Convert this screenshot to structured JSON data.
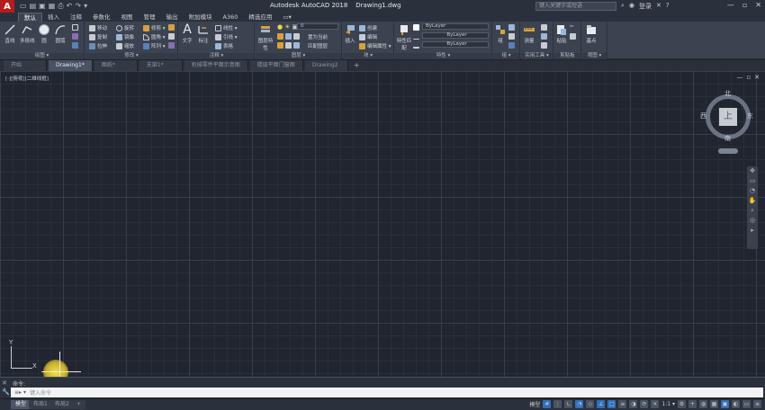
{
  "app": {
    "logo": "A",
    "title": "Autodesk AutoCAD 2018",
    "filename": "Drawing1.dwg",
    "search_placeholder": "键入关键字或短语",
    "login": "登录",
    "window_controls": [
      "—",
      "▫",
      "✕"
    ]
  },
  "menu": {
    "tabs": [
      "默认",
      "插入",
      "注释",
      "参数化",
      "视图",
      "管理",
      "输出",
      "附加模块",
      "A360",
      "精选应用",
      "▭▾"
    ]
  },
  "ribbon": {
    "draw": {
      "title": "绘图 ▾",
      "line": "直线",
      "polyline": "多段线",
      "circle": "圆",
      "arc": "圆弧"
    },
    "modify": {
      "title": "修改 ▾",
      "move": "移动",
      "rotate": "旋转",
      "trim": "修剪 ▾",
      "copy": "复制",
      "mirror": "镜像",
      "fillet": "圆角 ▾",
      "stretch": "拉伸",
      "scale": "缩放",
      "array": "阵列 ▾"
    },
    "annotation": {
      "title": "注释 ▾",
      "text": "文字",
      "dimension": "标注",
      "linear": "线性 ▾",
      "leader": "引线 ▾",
      "table": "表格"
    },
    "layers": {
      "title": "图层 ▾",
      "layer_props": "图层特性",
      "layer_combo": "0",
      "make_current": "置为当前",
      "match_layer": "匹配图层"
    },
    "block": {
      "title": "块 ▾",
      "insert": "插入",
      "create": "创建",
      "edit": "编辑",
      "edit_attr": "编辑属性 ▾"
    },
    "properties": {
      "title": "特性 ▾",
      "match": "特性匹配",
      "color": "ByLayer",
      "linetype": "ByLayer",
      "lineweight": "ByLayer"
    },
    "groups": {
      "title": "组 ▾",
      "group": "组"
    },
    "utilities": {
      "title": "实用工具 ▾",
      "measure": "测量"
    },
    "clipboard": {
      "title": "剪贴板",
      "paste": "粘贴"
    },
    "view": {
      "title": "视图 ▾",
      "base": "基点"
    }
  },
  "doctabs": {
    "items": [
      "开始",
      "Drawing1*",
      "图纸*",
      "支架1*",
      "机械零件平面示意图",
      "楼层平面门窗图",
      "Drawing2"
    ],
    "add": "+"
  },
  "viewport": {
    "label": "[-][俯视][二维线框]",
    "controls": [
      "—",
      "▫",
      "✕"
    ],
    "viewcube": {
      "face": "上",
      "north": "北",
      "south": "南",
      "east": "东",
      "west": "西"
    },
    "ucs": {
      "x": "X",
      "y": "Y"
    },
    "nav_buttons": [
      "✥",
      "▭",
      "◔",
      "✋",
      "⌕",
      "◎",
      "▸"
    ]
  },
  "command": {
    "history": "命令:",
    "prompt": "≡▸ ▾",
    "placeholder": "键入命令",
    "side_buttons": [
      "✕",
      "🔧"
    ]
  },
  "status": {
    "layout_tabs": [
      "模型",
      "布局1",
      "布局2"
    ],
    "add": "+",
    "model_label": "模型",
    "scale": "1:1 ▾"
  },
  "colors": {
    "accent": "#2f6fbf",
    "logo": "#b51c1c",
    "canvas": "#21252f",
    "ribbon": "#3b4351",
    "cursor_highlight": "#ffe646"
  }
}
